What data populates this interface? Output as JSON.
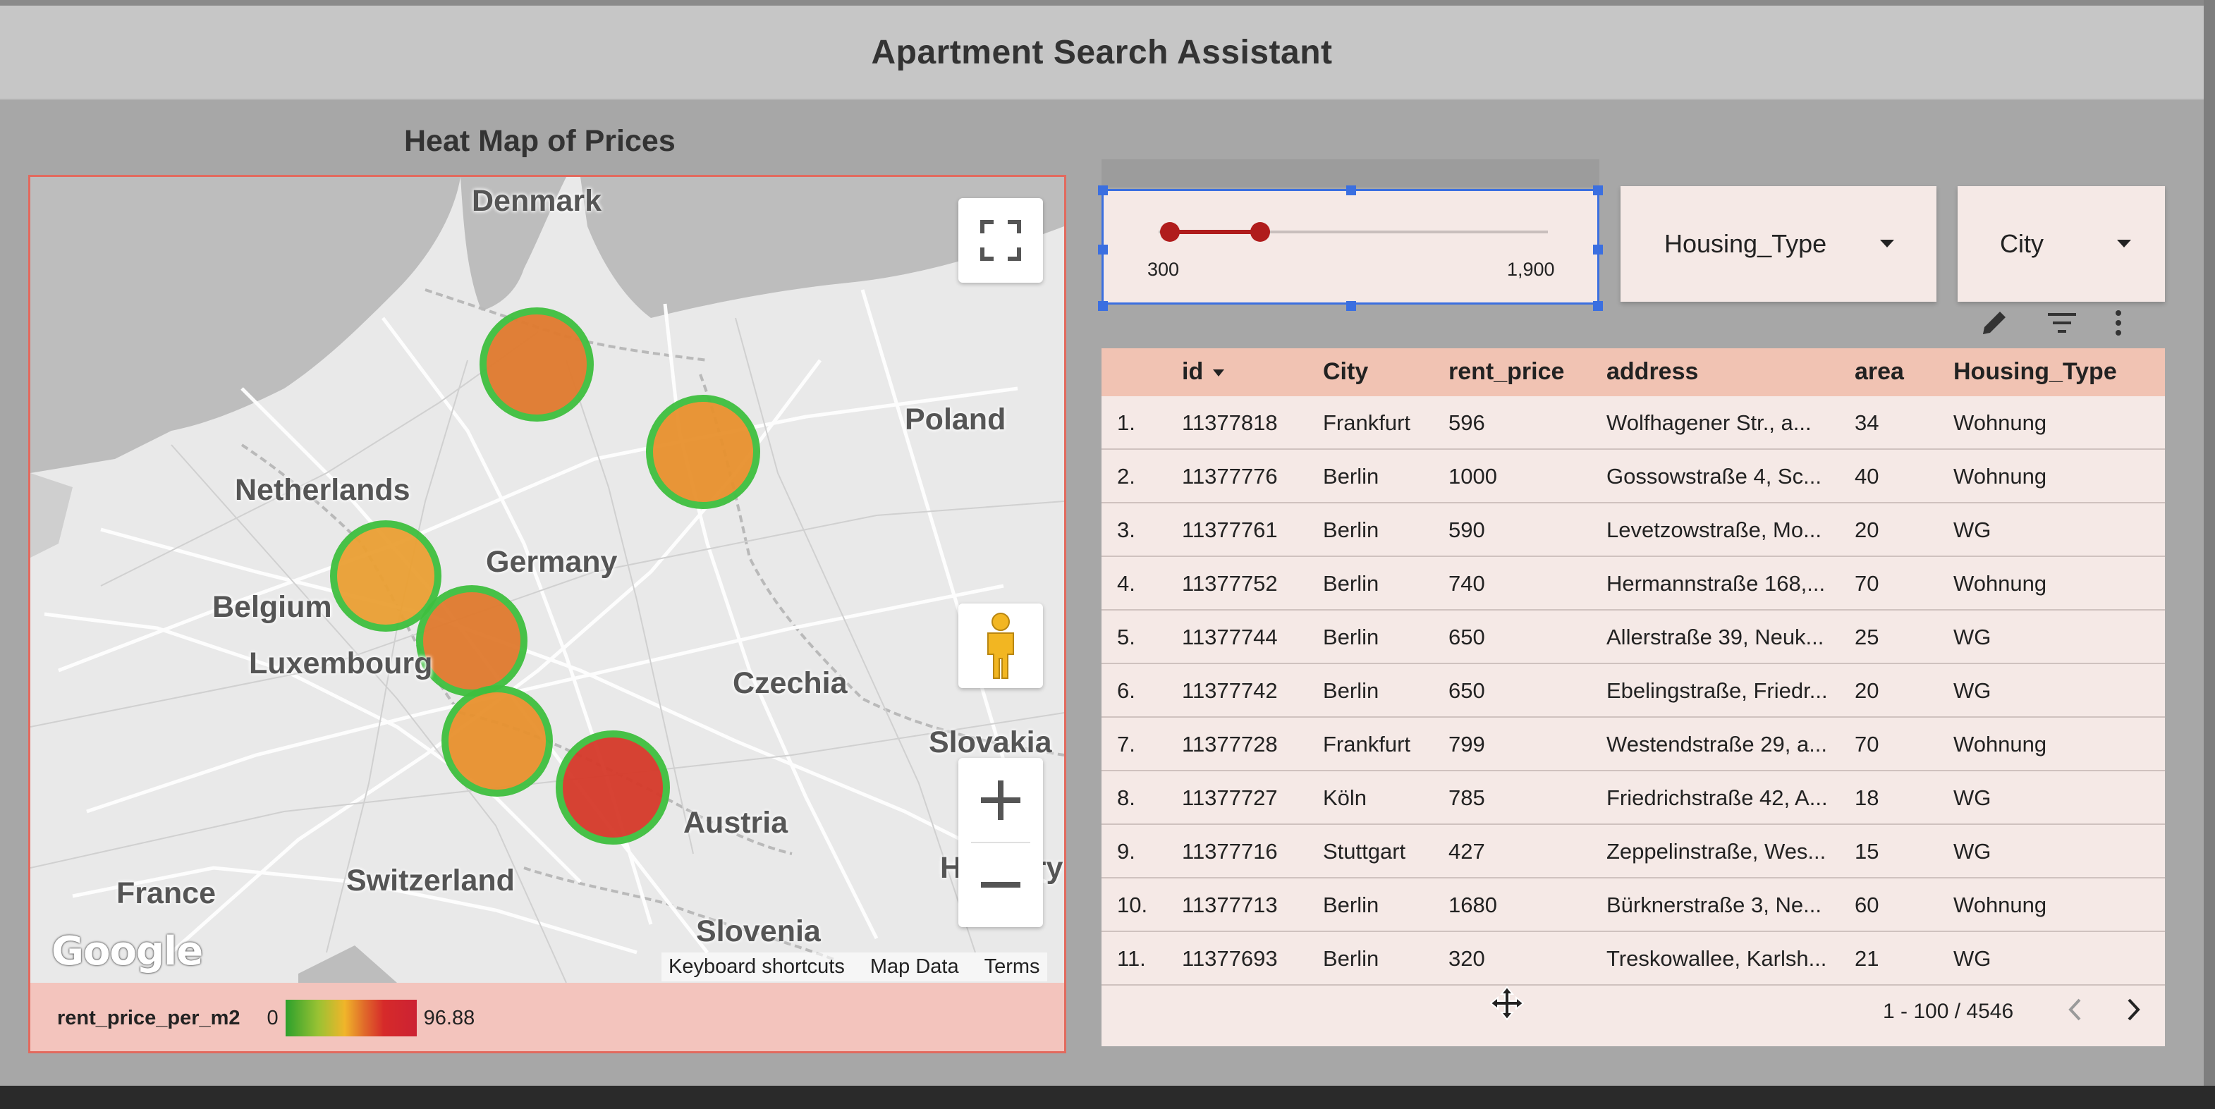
{
  "app": {
    "title": "Apartment Search Assistant"
  },
  "map": {
    "heading": "Heat Map of Prices",
    "labels": {
      "denmark": "Denmark",
      "poland": "Poland",
      "netherlands": "Netherlands",
      "germany": "Germany",
      "belgium": "Belgium",
      "luxembourg": "Luxembourg",
      "czechia": "Czechia",
      "slovakia": "Slovakia",
      "austria": "Austria",
      "hungary": "Hungary",
      "france": "France",
      "switzerland": "Switzerland",
      "slovenia": "Slovenia"
    },
    "hotspots": [
      {
        "name": "hotspot-hamburg",
        "level": 0.55,
        "color": "#e07a2e"
      },
      {
        "name": "hotspot-berlin",
        "level": 0.45,
        "color": "#e8912e"
      },
      {
        "name": "hotspot-cologne",
        "level": 0.4,
        "color": "#eba034"
      },
      {
        "name": "hotspot-frankfurt",
        "level": 0.55,
        "color": "#e07a2e"
      },
      {
        "name": "hotspot-stuttgart",
        "level": 0.45,
        "color": "#e8912e"
      },
      {
        "name": "hotspot-munich",
        "level": 0.85,
        "color": "#d63a2a"
      }
    ],
    "footer": {
      "logo": "Google",
      "keyboard": "Keyboard shortcuts",
      "map_data": "Map Data",
      "terms": "Terms"
    },
    "legend": {
      "metric": "rent_price_per_m2",
      "min": "0",
      "max": "96.88"
    }
  },
  "filters": {
    "rent_slider": {
      "min_label": "300",
      "max_label": "1,900"
    },
    "housing_type": {
      "label": "Housing_Type"
    },
    "city": {
      "label": "City"
    }
  },
  "table": {
    "columns": {
      "id": "id",
      "city": "City",
      "rent_price": "rent_price",
      "address": "address",
      "area": "area",
      "housing_type": "Housing_Type"
    },
    "rows": [
      {
        "n": "1.",
        "id": "11377818",
        "city": "Frankfurt",
        "rent": "596",
        "address": "Wolfhagener Str., a...",
        "area": "34",
        "type": "Wohnung"
      },
      {
        "n": "2.",
        "id": "11377776",
        "city": "Berlin",
        "rent": "1000",
        "address": "Gossowstraße 4, Sc...",
        "area": "40",
        "type": "Wohnung"
      },
      {
        "n": "3.",
        "id": "11377761",
        "city": "Berlin",
        "rent": "590",
        "address": "Levetzowstraße, Mo...",
        "area": "20",
        "type": "WG"
      },
      {
        "n": "4.",
        "id": "11377752",
        "city": "Berlin",
        "rent": "740",
        "address": "Hermannstraße 168,...",
        "area": "70",
        "type": "Wohnung"
      },
      {
        "n": "5.",
        "id": "11377744",
        "city": "Berlin",
        "rent": "650",
        "address": "Allerstraße 39, Neuk...",
        "area": "25",
        "type": "WG"
      },
      {
        "n": "6.",
        "id": "11377742",
        "city": "Berlin",
        "rent": "650",
        "address": "Ebelingstraße, Friedr...",
        "area": "20",
        "type": "WG"
      },
      {
        "n": "7.",
        "id": "11377728",
        "city": "Frankfurt",
        "rent": "799",
        "address": "Westendstraße 29, a...",
        "area": "70",
        "type": "Wohnung"
      },
      {
        "n": "8.",
        "id": "11377727",
        "city": "Köln",
        "rent": "785",
        "address": "Friedrichstraße 42, A...",
        "area": "18",
        "type": "WG"
      },
      {
        "n": "9.",
        "id": "11377716",
        "city": "Stuttgart",
        "rent": "427",
        "address": "Zeppelinstraße, Wes...",
        "area": "15",
        "type": "WG"
      },
      {
        "n": "10.",
        "id": "11377713",
        "city": "Berlin",
        "rent": "1680",
        "address": "Bürknerstraße 3, Ne...",
        "area": "60",
        "type": "Wohnung"
      },
      {
        "n": "11.",
        "id": "11377693",
        "city": "Berlin",
        "rent": "320",
        "address": "Treskowallee, Karlsh...",
        "area": "21",
        "type": "WG"
      }
    ],
    "pagination": "1 - 100 / 4546"
  },
  "icons": {
    "fullscreen": "fullscreen-icon",
    "pegman": "pegman-icon",
    "zoom_in": "plus-icon",
    "zoom_out": "minus-icon",
    "edit": "pencil-icon",
    "filter": "filter-icon",
    "more": "more-vert-icon",
    "prev": "chevron-left-icon",
    "next": "chevron-right-icon",
    "move": "move-cursor-icon"
  }
}
